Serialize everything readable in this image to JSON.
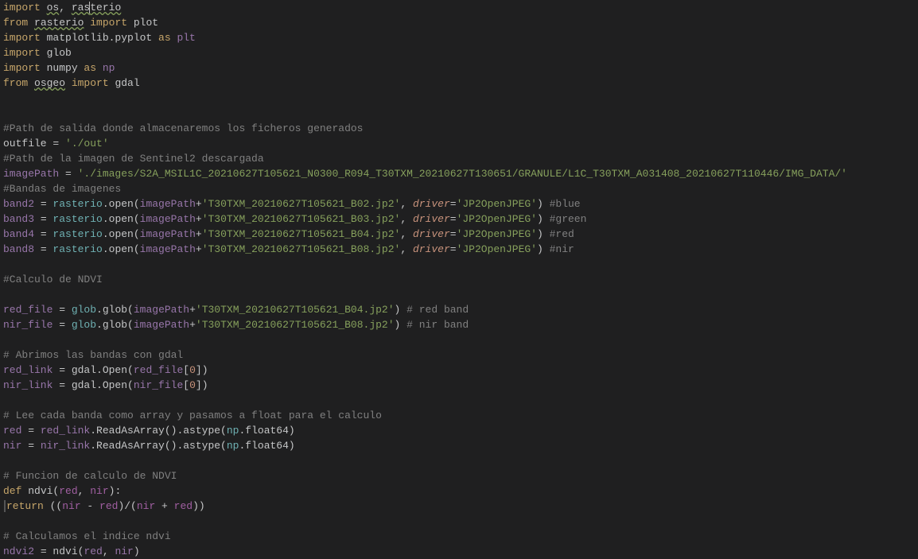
{
  "lines": [
    {
      "tokens": [
        {
          "t": "import ",
          "c": "kw-import"
        },
        {
          "t": "os",
          "c": "underline-warn"
        },
        {
          "t": ", ",
          "c": "ident"
        },
        {
          "t": "ras",
          "c": "underline-warn"
        },
        {
          "t": "terio",
          "c": "underline-warn cursor",
          "cursor": true
        }
      ]
    },
    {
      "tokens": [
        {
          "t": "from ",
          "c": "kw-import"
        },
        {
          "t": "rasterio",
          "c": "underline-warn"
        },
        {
          "t": " import ",
          "c": "kw-import"
        },
        {
          "t": "plot",
          "c": "ident"
        }
      ]
    },
    {
      "tokens": [
        {
          "t": "import ",
          "c": "kw-import"
        },
        {
          "t": "matplotlib.pyplot ",
          "c": "ident"
        },
        {
          "t": "as ",
          "c": "kw-import"
        },
        {
          "t": "plt",
          "c": "mod-purple"
        }
      ]
    },
    {
      "tokens": [
        {
          "t": "import ",
          "c": "kw-import"
        },
        {
          "t": "glob",
          "c": "ident"
        }
      ]
    },
    {
      "tokens": [
        {
          "t": "import ",
          "c": "kw-import"
        },
        {
          "t": "numpy ",
          "c": "ident"
        },
        {
          "t": "as ",
          "c": "kw-import"
        },
        {
          "t": "np",
          "c": "mod-purple"
        }
      ]
    },
    {
      "tokens": [
        {
          "t": "from ",
          "c": "kw-import"
        },
        {
          "t": "osgeo",
          "c": "underline-warn"
        },
        {
          "t": " import ",
          "c": "kw-import"
        },
        {
          "t": "gdal",
          "c": "ident"
        }
      ]
    },
    {
      "tokens": [
        {
          "t": "",
          "c": "ident"
        }
      ]
    },
    {
      "tokens": [
        {
          "t": "",
          "c": "ident"
        }
      ]
    },
    {
      "tokens": [
        {
          "t": "#Path de salida donde almacenaremos los ficheros generados",
          "c": "comment"
        }
      ]
    },
    {
      "tokens": [
        {
          "t": "outfile = ",
          "c": "ident"
        },
        {
          "t": "'./out'",
          "c": "string"
        }
      ]
    },
    {
      "tokens": [
        {
          "t": "#Path de la imagen de Sentinel2 descargada",
          "c": "comment"
        }
      ]
    },
    {
      "tokens": [
        {
          "t": "imagePath",
          "c": "mod-purple"
        },
        {
          "t": " = ",
          "c": "ident"
        },
        {
          "t": "'./images/S2A_MSIL1C_20210627T105621_N0300_R094_T30TXM_20210627T130651/GRANULE/L1C_T30TXM_A031408_20210627T110446/IMG_DATA/'",
          "c": "string"
        }
      ]
    },
    {
      "tokens": [
        {
          "t": "#Bandas de imagenes",
          "c": "comment"
        }
      ]
    },
    {
      "tokens": [
        {
          "t": "band2",
          "c": "mod-purple"
        },
        {
          "t": " = ",
          "c": "ident"
        },
        {
          "t": "rasterio",
          "c": "cyan"
        },
        {
          "t": ".open(",
          "c": "ident"
        },
        {
          "t": "imagePath",
          "c": "mod-purple"
        },
        {
          "t": "+",
          "c": "ident"
        },
        {
          "t": "'T30TXM_20210627T105621_B02.jp2'",
          "c": "string"
        },
        {
          "t": ", ",
          "c": "ident"
        },
        {
          "t": "driver",
          "c": "param"
        },
        {
          "t": "=",
          "c": "ident"
        },
        {
          "t": "'JP2OpenJPEG'",
          "c": "string"
        },
        {
          "t": ") ",
          "c": "ident"
        },
        {
          "t": "#blue",
          "c": "comment"
        }
      ]
    },
    {
      "tokens": [
        {
          "t": "band3",
          "c": "mod-purple"
        },
        {
          "t": " = ",
          "c": "ident"
        },
        {
          "t": "rasterio",
          "c": "cyan"
        },
        {
          "t": ".open(",
          "c": "ident"
        },
        {
          "t": "imagePath",
          "c": "mod-purple"
        },
        {
          "t": "+",
          "c": "ident"
        },
        {
          "t": "'T30TXM_20210627T105621_B03.jp2'",
          "c": "string"
        },
        {
          "t": ", ",
          "c": "ident"
        },
        {
          "t": "driver",
          "c": "param"
        },
        {
          "t": "=",
          "c": "ident"
        },
        {
          "t": "'JP2OpenJPEG'",
          "c": "string"
        },
        {
          "t": ") ",
          "c": "ident"
        },
        {
          "t": "#green",
          "c": "comment"
        }
      ]
    },
    {
      "tokens": [
        {
          "t": "band4",
          "c": "mod-purple"
        },
        {
          "t": " = ",
          "c": "ident"
        },
        {
          "t": "rasterio",
          "c": "cyan"
        },
        {
          "t": ".open(",
          "c": "ident"
        },
        {
          "t": "imagePath",
          "c": "mod-purple"
        },
        {
          "t": "+",
          "c": "ident"
        },
        {
          "t": "'T30TXM_20210627T105621_B04.jp2'",
          "c": "string"
        },
        {
          "t": ", ",
          "c": "ident"
        },
        {
          "t": "driver",
          "c": "param"
        },
        {
          "t": "=",
          "c": "ident"
        },
        {
          "t": "'JP2OpenJPEG'",
          "c": "string"
        },
        {
          "t": ") ",
          "c": "ident"
        },
        {
          "t": "#red",
          "c": "comment"
        }
      ]
    },
    {
      "tokens": [
        {
          "t": "band8",
          "c": "mod-purple"
        },
        {
          "t": " = ",
          "c": "ident"
        },
        {
          "t": "rasterio",
          "c": "cyan"
        },
        {
          "t": ".open(",
          "c": "ident"
        },
        {
          "t": "imagePath",
          "c": "mod-purple"
        },
        {
          "t": "+",
          "c": "ident"
        },
        {
          "t": "'T30TXM_20210627T105621_B08.jp2'",
          "c": "string"
        },
        {
          "t": ", ",
          "c": "ident"
        },
        {
          "t": "driver",
          "c": "param"
        },
        {
          "t": "=",
          "c": "ident"
        },
        {
          "t": "'JP2OpenJPEG'",
          "c": "string"
        },
        {
          "t": ") ",
          "c": "ident"
        },
        {
          "t": "#nir",
          "c": "comment"
        }
      ]
    },
    {
      "tokens": [
        {
          "t": "",
          "c": "ident"
        }
      ]
    },
    {
      "tokens": [
        {
          "t": "#Calculo de NDVI",
          "c": "comment"
        }
      ]
    },
    {
      "tokens": [
        {
          "t": "",
          "c": "ident"
        }
      ]
    },
    {
      "tokens": [
        {
          "t": "red_file",
          "c": "mod-purple"
        },
        {
          "t": " = ",
          "c": "ident"
        },
        {
          "t": "glob",
          "c": "cyan"
        },
        {
          "t": ".glob(",
          "c": "ident"
        },
        {
          "t": "imagePath",
          "c": "mod-purple"
        },
        {
          "t": "+",
          "c": "ident"
        },
        {
          "t": "'T30TXM_20210627T105621_B04.jp2'",
          "c": "string"
        },
        {
          "t": ") ",
          "c": "ident"
        },
        {
          "t": "# red band",
          "c": "comment"
        }
      ]
    },
    {
      "tokens": [
        {
          "t": "nir_file",
          "c": "mod-purple"
        },
        {
          "t": " = ",
          "c": "ident"
        },
        {
          "t": "glob",
          "c": "cyan"
        },
        {
          "t": ".glob(",
          "c": "ident"
        },
        {
          "t": "imagePath",
          "c": "mod-purple"
        },
        {
          "t": "+",
          "c": "ident"
        },
        {
          "t": "'T30TXM_20210627T105621_B08.jp2'",
          "c": "string"
        },
        {
          "t": ") ",
          "c": "ident"
        },
        {
          "t": "# nir band",
          "c": "comment"
        }
      ]
    },
    {
      "tokens": [
        {
          "t": "",
          "c": "ident"
        }
      ]
    },
    {
      "tokens": [
        {
          "t": "# Abrimos las bandas con gdal",
          "c": "comment"
        }
      ]
    },
    {
      "tokens": [
        {
          "t": "red_link",
          "c": "mod-purple"
        },
        {
          "t": " = gdal.Open(",
          "c": "ident"
        },
        {
          "t": "red_file",
          "c": "mod-purple"
        },
        {
          "t": "[",
          "c": "ident"
        },
        {
          "t": "0",
          "c": "num-orange"
        },
        {
          "t": "])",
          "c": "ident"
        }
      ]
    },
    {
      "tokens": [
        {
          "t": "nir_link",
          "c": "mod-purple"
        },
        {
          "t": " = gdal.Open(",
          "c": "ident"
        },
        {
          "t": "nir_file",
          "c": "mod-purple"
        },
        {
          "t": "[",
          "c": "ident"
        },
        {
          "t": "0",
          "c": "num-orange"
        },
        {
          "t": "])",
          "c": "ident"
        }
      ]
    },
    {
      "tokens": [
        {
          "t": "",
          "c": "ident"
        }
      ]
    },
    {
      "tokens": [
        {
          "t": "# Lee cada banda como array y pasamos a float para el calculo",
          "c": "comment"
        }
      ]
    },
    {
      "tokens": [
        {
          "t": "red",
          "c": "mod-purple"
        },
        {
          "t": " = ",
          "c": "ident"
        },
        {
          "t": "red_link",
          "c": "mod-purple"
        },
        {
          "t": ".ReadAsArray().astype(",
          "c": "ident"
        },
        {
          "t": "np",
          "c": "cyan"
        },
        {
          "t": ".float64)",
          "c": "ident"
        }
      ]
    },
    {
      "tokens": [
        {
          "t": "nir",
          "c": "mod-purple"
        },
        {
          "t": " = ",
          "c": "ident"
        },
        {
          "t": "nir_link",
          "c": "mod-purple"
        },
        {
          "t": ".ReadAsArray().astype(",
          "c": "ident"
        },
        {
          "t": "np",
          "c": "cyan"
        },
        {
          "t": ".float64)",
          "c": "ident"
        }
      ]
    },
    {
      "tokens": [
        {
          "t": "",
          "c": "ident"
        }
      ]
    },
    {
      "tokens": [
        {
          "t": "# Funcion de calculo de NDVI",
          "c": "comment"
        }
      ]
    },
    {
      "tokens": [
        {
          "t": "def ",
          "c": "kw-def"
        },
        {
          "t": "ndvi(",
          "c": "ident"
        },
        {
          "t": "red",
          "c": "typefloat"
        },
        {
          "t": ", ",
          "c": "ident"
        },
        {
          "t": "nir",
          "c": "typefloat"
        },
        {
          "t": "):",
          "c": "ident"
        }
      ]
    },
    {
      "tokens": [
        {
          "bar": true
        },
        {
          "t": "return ",
          "c": "kw-orange"
        },
        {
          "t": "((",
          "c": "ident"
        },
        {
          "t": "nir",
          "c": "typefloat"
        },
        {
          "t": " - ",
          "c": "ident"
        },
        {
          "t": "red",
          "c": "typefloat"
        },
        {
          "t": ")/(",
          "c": "ident"
        },
        {
          "t": "nir",
          "c": "typefloat"
        },
        {
          "t": " + ",
          "c": "ident"
        },
        {
          "t": "red",
          "c": "typefloat"
        },
        {
          "t": "))",
          "c": "ident"
        }
      ]
    },
    {
      "tokens": [
        {
          "t": "",
          "c": "ident"
        }
      ]
    },
    {
      "tokens": [
        {
          "t": "# Calculamos el indice ndvi",
          "c": "comment"
        }
      ]
    },
    {
      "tokens": [
        {
          "t": "ndvi2",
          "c": "mod-purple"
        },
        {
          "t": " = ndvi(",
          "c": "ident"
        },
        {
          "t": "red",
          "c": "mod-purple"
        },
        {
          "t": ", ",
          "c": "ident"
        },
        {
          "t": "nir",
          "c": "mod-purple"
        },
        {
          "t": ")",
          "c": "ident"
        }
      ]
    }
  ]
}
